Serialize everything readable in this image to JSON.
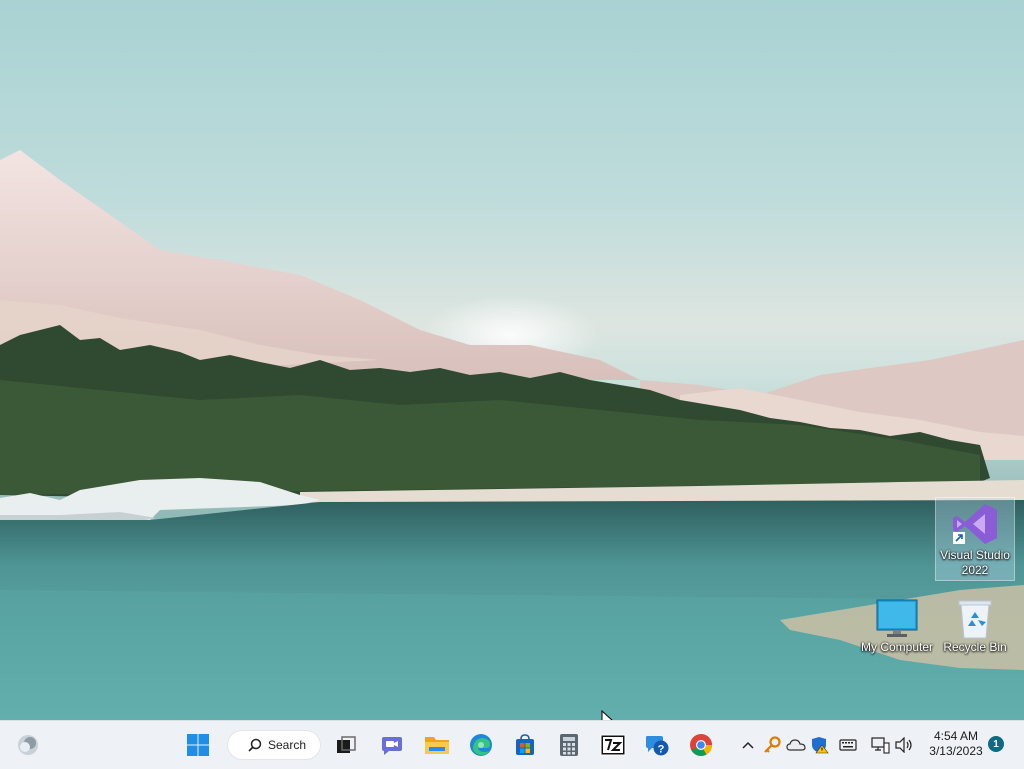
{
  "desktop": {
    "icons": [
      {
        "name": "Visual Studio 2022",
        "line1": "Visual Studio",
        "line2": "2022"
      },
      {
        "name": "My Computer"
      },
      {
        "name": "Recycle Bin"
      }
    ]
  },
  "taskbar": {
    "search_label": "Search",
    "pinned_apps": [
      "widgets-icon",
      "start-icon",
      "search",
      "task-view-icon",
      "teams-chat-icon",
      "file-explorer-icon",
      "edge-icon",
      "microsoft-store-icon",
      "calculator-icon",
      "7zip-icon",
      "get-help-icon",
      "chrome-icon"
    ],
    "tray": {
      "icons": [
        "show-hidden-icons-chevron",
        "key-icon",
        "onedrive-icon",
        "security-warning-icon",
        "keyboard-icon",
        "network-icon",
        "volume-icon"
      ],
      "time": "4:54 AM",
      "date": "3/13/2023",
      "notification_count": "1"
    }
  },
  "colors": {
    "taskbar_bg": "#eef2f6",
    "accent": "#0f6a86",
    "vs_purple": "#8a5cd6"
  }
}
